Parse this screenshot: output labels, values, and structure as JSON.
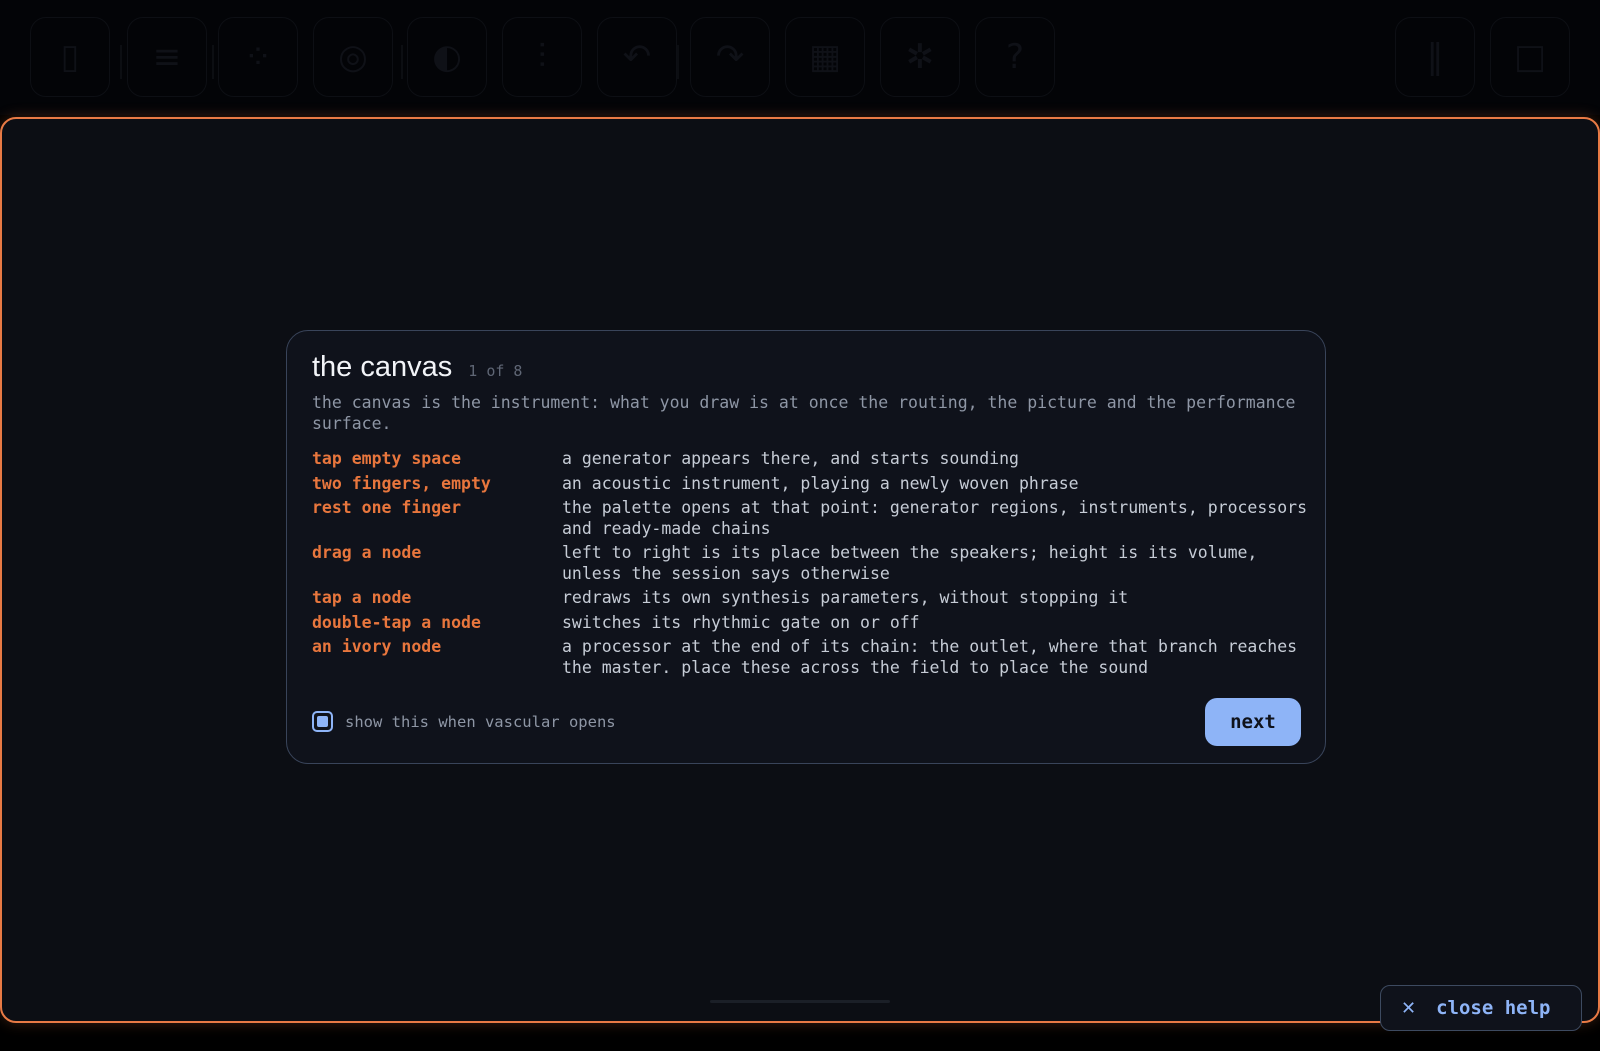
{
  "toolbar": {
    "icons": [
      "save-icon",
      "menu-icon",
      "nodes-icon",
      "target-icon",
      "compass-icon",
      "sliders-icon",
      "undo-icon",
      "redo-icon",
      "grid-icon",
      "gear-icon",
      "help-icon",
      "pause-icon",
      "stop-icon"
    ]
  },
  "help": {
    "title": "the canvas",
    "step": "1 of 8",
    "intro": "the canvas is the instrument: what you draw is at once the routing, the picture and the performance surface.",
    "gestures": [
      {
        "key": "tap empty space",
        "desc": "a generator appears there, and starts sounding"
      },
      {
        "key": "two fingers, empty",
        "desc": "an acoustic instrument, playing a newly woven phrase"
      },
      {
        "key": "rest one finger",
        "desc": "the palette opens at that point: generator regions, instruments, processors and ready-made chains"
      },
      {
        "key": "drag a node",
        "desc": "left to right is its place between the speakers; height is its volume, unless the session says otherwise"
      },
      {
        "key": "tap a node",
        "desc": "redraws its own synthesis parameters, without stopping it"
      },
      {
        "key": "double-tap a node",
        "desc": "switches its rhythmic gate on or off"
      },
      {
        "key": "an ivory node",
        "desc": "a processor at the end of its chain: the outlet, where that branch reaches the master. place these across the field to place the sound"
      }
    ],
    "show_on_open_label": "show this when vascular opens",
    "show_on_open_checked": true,
    "next_label": "next"
  },
  "close_help": {
    "icon": "close-icon",
    "label": "close help"
  },
  "colors": {
    "accent_orange": "#e8763d",
    "frame_orange": "#e87a45",
    "accent_blue": "#8eb4f7",
    "dialog_bg": "#0f121b"
  }
}
